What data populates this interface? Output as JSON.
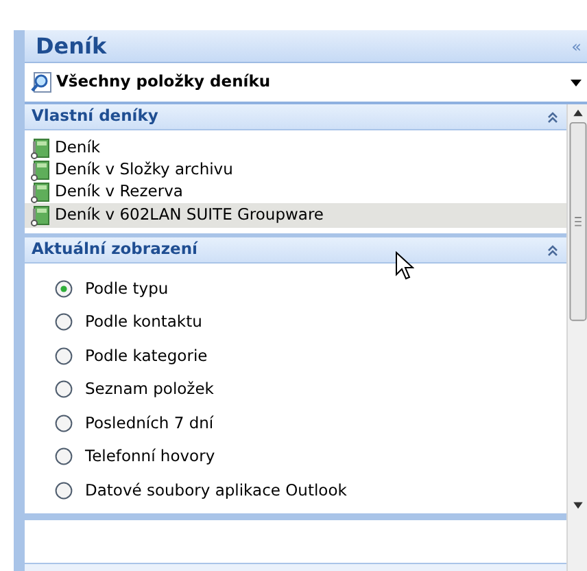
{
  "pane": {
    "title": "Deník",
    "collapse_glyph": "«"
  },
  "view_selector": {
    "label": "Všechny položky deníku"
  },
  "sections": [
    {
      "title": "Vlastní deníky",
      "expanded": true,
      "kind": "folders",
      "items": [
        {
          "label": "Deník",
          "hovered": false
        },
        {
          "label": "Deník v Složky archivu",
          "hovered": false
        },
        {
          "label": "Deník v Rezerva",
          "hovered": false
        },
        {
          "label": "Deník v 602LAN SUITE Groupware",
          "hovered": true
        }
      ]
    },
    {
      "title": "Aktuální zobrazení",
      "expanded": true,
      "kind": "views",
      "items": [
        {
          "label": "Podle typu",
          "selected": true
        },
        {
          "label": "Podle kontaktu",
          "selected": false
        },
        {
          "label": "Podle kategorie",
          "selected": false
        },
        {
          "label": "Seznam položek",
          "selected": false
        },
        {
          "label": "Posledních 7 dní",
          "selected": false
        },
        {
          "label": "Telefonní hovory",
          "selected": false
        },
        {
          "label": "Datové soubory aplikace Outlook",
          "selected": false
        }
      ]
    }
  ]
}
